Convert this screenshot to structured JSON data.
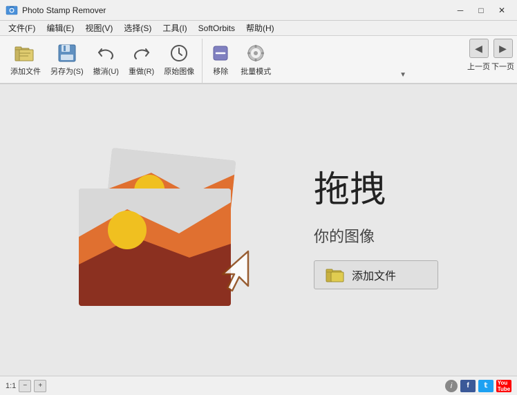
{
  "window": {
    "title": "Photo Stamp Remover",
    "icon": "📷",
    "min_btn": "─",
    "max_btn": "□",
    "close_btn": "✕"
  },
  "menubar": {
    "items": [
      {
        "id": "file",
        "label": "文件(F)"
      },
      {
        "id": "edit",
        "label": "编辑(E)"
      },
      {
        "id": "view",
        "label": "视图(V)"
      },
      {
        "id": "select",
        "label": "选择(S)"
      },
      {
        "id": "tools",
        "label": "工具(I)"
      },
      {
        "id": "softorbits",
        "label": "SoftOrbits"
      },
      {
        "id": "help",
        "label": "帮助(H)"
      }
    ]
  },
  "toolbar": {
    "buttons": [
      {
        "id": "add-file",
        "label": "添加文件",
        "icon": "folder"
      },
      {
        "id": "save-as",
        "label": "另存为(S)",
        "icon": "save"
      },
      {
        "id": "undo",
        "label": "撤消(U)",
        "icon": "undo"
      },
      {
        "id": "redo",
        "label": "重做(R)",
        "icon": "redo"
      },
      {
        "id": "original",
        "label": "原始图像",
        "icon": "clock"
      },
      {
        "id": "remove",
        "label": "移除",
        "icon": "wand"
      },
      {
        "id": "batch",
        "label": "批量模式",
        "icon": "settings"
      }
    ],
    "nav": {
      "prev_label": "上一页",
      "next_label": "下一页"
    },
    "dropdown_arrow": "▼"
  },
  "main": {
    "drop_title": "拖拽",
    "drop_subtitle": "你的图像",
    "add_file_label": "添加文件"
  },
  "statusbar": {
    "zoom": "1:1",
    "info_icon": "i"
  }
}
